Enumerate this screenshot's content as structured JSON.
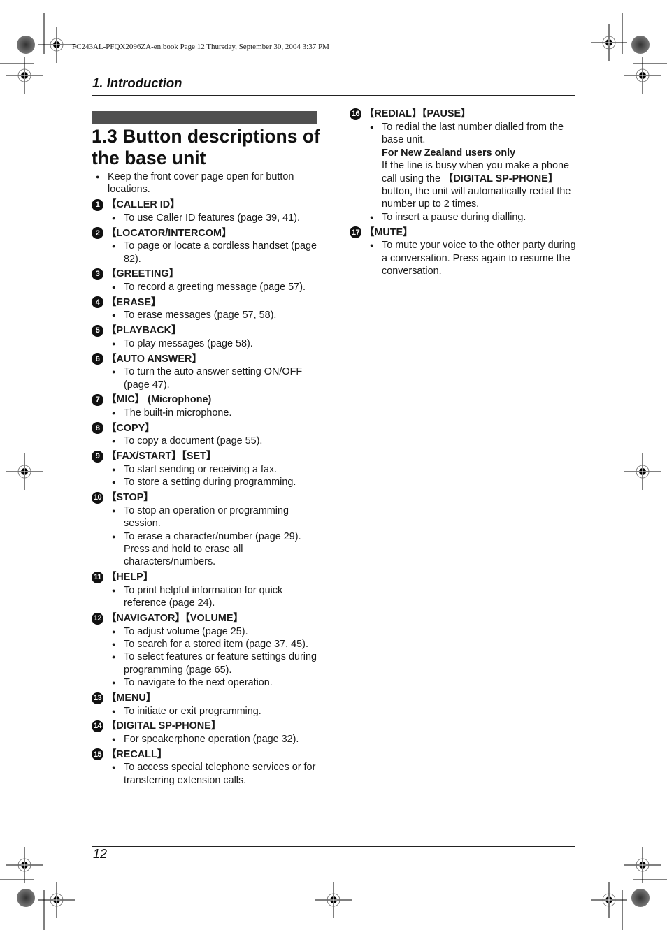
{
  "print_header": "FC243AL-PFQX2096ZA-en.book  Page 12  Thursday, September 30, 2004  3:37 PM",
  "section": "1. Introduction",
  "title": "1.3 Button descriptions of the base unit",
  "intro": "Keep the front cover page open for button locations.",
  "items_left": [
    {
      "num": "1",
      "label": "【CALLER ID】",
      "bullets": [
        "To use Caller ID features (page 39, 41)."
      ]
    },
    {
      "num": "2",
      "label": "【LOCATOR/INTERCOM】",
      "bullets": [
        "To page or locate a cordless handset (page 82)."
      ]
    },
    {
      "num": "3",
      "label": "【GREETING】",
      "bullets": [
        "To record a greeting message (page 57)."
      ]
    },
    {
      "num": "4",
      "label": "【ERASE】",
      "bullets": [
        "To erase messages (page 57, 58)."
      ]
    },
    {
      "num": "5",
      "label": "【PLAYBACK】",
      "bullets": [
        "To play messages (page 58)."
      ]
    },
    {
      "num": "6",
      "label": "【AUTO ANSWER】",
      "bullets": [
        "To turn the auto answer setting ON/OFF (page 47)."
      ]
    },
    {
      "num": "7",
      "label": "【MIC】 (Microphone)",
      "bullets": [
        "The built-in microphone."
      ]
    },
    {
      "num": "8",
      "label": "【COPY】",
      "bullets": [
        "To copy a document (page 55)."
      ]
    },
    {
      "num": "9",
      "label": "【FAX/START】【SET】",
      "bullets": [
        "To start sending or receiving a fax.",
        "To store a setting during programming."
      ]
    },
    {
      "num": "10",
      "label": "【STOP】",
      "bullets": [
        "To stop an operation or programming session.",
        "To erase a character/number (page 29). Press and hold to erase all characters/numbers."
      ]
    },
    {
      "num": "11",
      "label": "【HELP】",
      "bullets": [
        "To print helpful information for quick reference (page 24)."
      ]
    },
    {
      "num": "12",
      "label": "【NAVIGATOR】【VOLUME】",
      "bullets": [
        "To adjust volume (page 25).",
        "To search for a stored item (page 37, 45).",
        "To select features or feature settings during programming (page 65).",
        "To navigate to the next operation."
      ]
    },
    {
      "num": "13",
      "label": "【MENU】",
      "bullets": [
        "To initiate or exit programming."
      ]
    },
    {
      "num": "14",
      "label": "【DIGITAL SP-PHONE】",
      "bullets": [
        "For speakerphone operation (page 32)."
      ]
    },
    {
      "num": "15",
      "label": "【RECALL】",
      "bullets": [
        "To access special telephone services or for transferring extension calls."
      ]
    }
  ],
  "item16": {
    "num": "16",
    "label": "【REDIAL】【PAUSE】",
    "bullet1": "To redial the last number dialled from the base unit.",
    "nz_heading": "For New Zealand users only",
    "nz_text_before": "If the line is busy when you make a phone call using the ",
    "nz_button": "【DIGITAL SP-PHONE】",
    "nz_text_after": " button, the unit will automatically redial the number up to 2 times.",
    "bullet2": "To insert a pause during dialling."
  },
  "item17": {
    "num": "17",
    "label": "【MUTE】",
    "bullet1": "To mute your voice to the other party during a conversation. Press again to resume the conversation."
  },
  "page_number": "12"
}
